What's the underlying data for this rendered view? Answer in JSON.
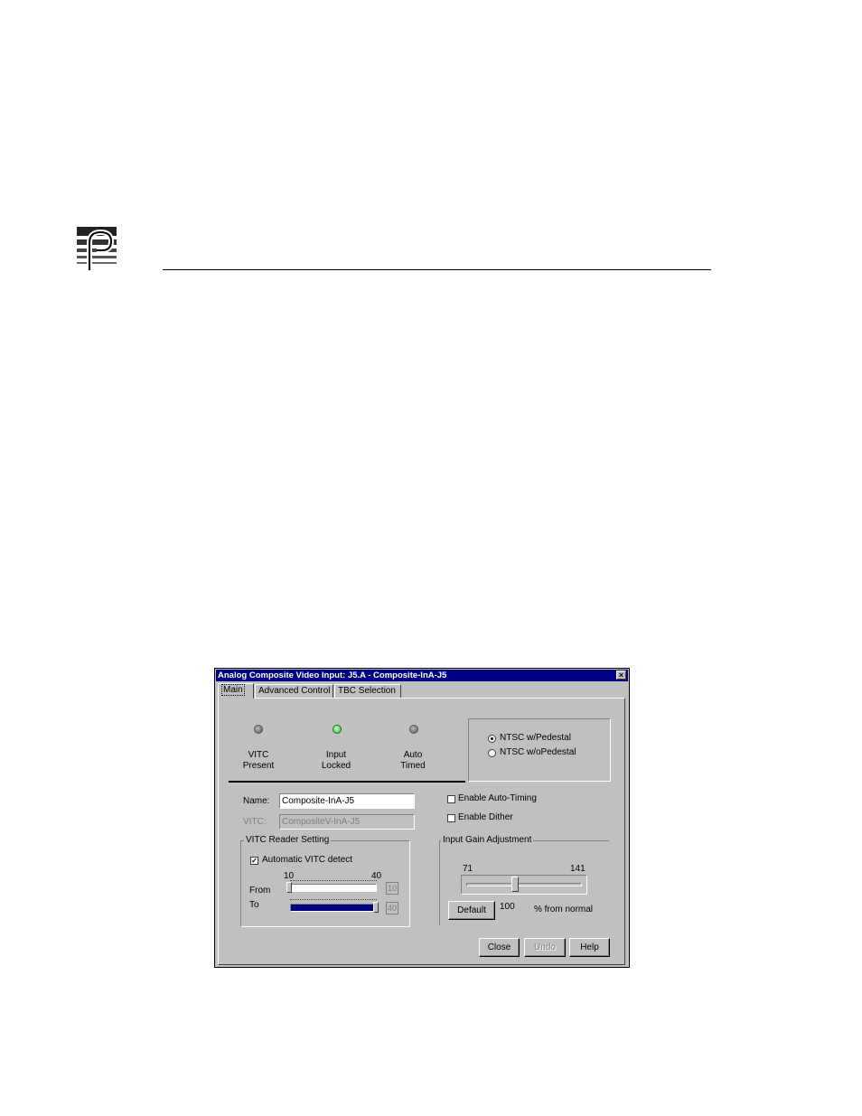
{
  "dialog": {
    "title": "Analog Composite Video Input: J5.A - Composite-InA-J5",
    "close_glyph": "×",
    "tabs": [
      {
        "label": "Main",
        "active": true
      },
      {
        "label": "Advanced Control",
        "active": false
      },
      {
        "label": "TBC Selection",
        "active": false
      }
    ],
    "indicators": [
      {
        "line1": "VITC",
        "line2": "Present",
        "state": "off"
      },
      {
        "line1": "Input",
        "line2": "Locked",
        "state": "on"
      },
      {
        "line1": "Auto",
        "line2": "Timed",
        "state": "off"
      }
    ],
    "standard_options": [
      {
        "label": "NTSC w/Pedestal",
        "selected": true
      },
      {
        "label": "NTSC w/oPedestal",
        "selected": false
      }
    ],
    "name": {
      "label": "Name:",
      "value": "Composite-InA-J5"
    },
    "vitc": {
      "label": "VITC:",
      "value": "CompositeV-InA-J5"
    },
    "enable_auto_timing": {
      "label": "Enable Auto-Timing",
      "checked": false
    },
    "enable_dither": {
      "label": "Enable Dither",
      "checked": false
    },
    "vitc_reader": {
      "title": "VITC Reader Setting",
      "auto_detect": {
        "label": "Automatic VITC detect",
        "checked": true,
        "glyph": "✓"
      },
      "range_min": "10",
      "range_max": "40",
      "from_label": "From",
      "to_label": "To",
      "from_value": "10",
      "to_value": "40"
    },
    "gain": {
      "title": "Input Gain Adjustment",
      "min": "71",
      "max": "141",
      "value": "100",
      "value_numeric": 100,
      "default_label": "Default",
      "unit_label": "% from normal"
    },
    "buttons": {
      "close": "Close",
      "undo": "Undo",
      "help": "Help"
    }
  }
}
